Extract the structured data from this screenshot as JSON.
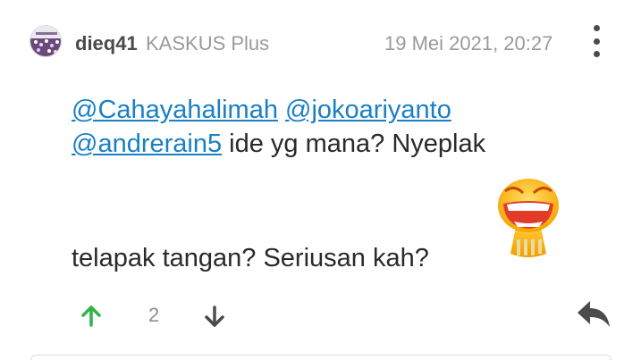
{
  "post": {
    "username": "dieq41",
    "badge": "KASKUS Plus",
    "timestamp": "19 Mei 2021, 20:27",
    "mentions": [
      "@Cahayahalimah",
      "@jokoariyanto",
      "@andrerain5"
    ],
    "text_part1": "ide yg mana? Nyeplak",
    "text_part2": "telapak tangan? Seriusan kah?",
    "vote_count": "2"
  },
  "icons": {
    "avatar": "avatar-image",
    "more": "more-vertical-icon",
    "emoticon": "laughing-emoticon",
    "upvote": "arrow-up-icon",
    "downvote": "arrow-down-icon",
    "reply": "reply-icon"
  },
  "colors": {
    "mention": "#1a7fc4",
    "upvote": "#2fb34a",
    "muted": "#9a9a9a"
  }
}
